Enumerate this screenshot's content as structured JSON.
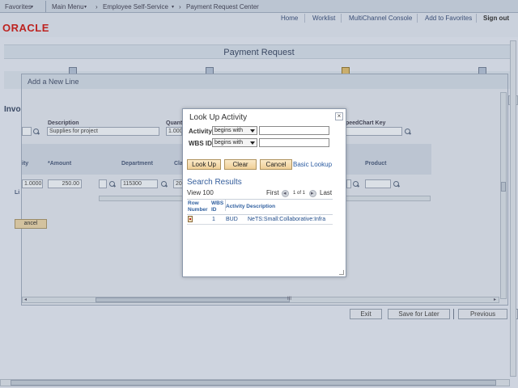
{
  "topbar": {
    "favorites": "Favorites",
    "main_menu": "Main Menu",
    "crumb1": "Employee Self-Service",
    "crumb2": "Payment Request Center"
  },
  "header": {
    "logo": "ORACLE",
    "links": [
      "Home",
      "Worklist",
      "MultiChannel Console",
      "Add to Favorites"
    ],
    "signout": "Sign out"
  },
  "page": {
    "title": "Payment Request"
  },
  "background_modal": {
    "title": "Add a New Line",
    "invoice_label": "Invo",
    "description_label": "Description",
    "description_value": "Supplies for project",
    "quantity_label": "Quant",
    "quantity_value": "1.000",
    "speedchart_label": "peedChart Key",
    "grid_headers": [
      "ity",
      "*Amount",
      "Department",
      "Cla",
      "Product"
    ],
    "row": {
      "qty": "1.0000",
      "amount": "250.00",
      "department": "115300",
      "class": "20"
    },
    "line_label": "Li",
    "cancel_button": "ancel"
  },
  "footer_buttons": {
    "exit": "Exit",
    "save_for_later": "Save for Later",
    "previous": "Previous"
  },
  "lookup": {
    "title": "Look Up Activity",
    "close": "×",
    "activity_label": "Activity:",
    "activity_operator": "begins with",
    "activity_value": "",
    "wbs_label": "WBS ID:",
    "wbs_operator": "begins with",
    "wbs_value": "",
    "buttons": {
      "lookup": "Look Up",
      "clear": "Clear",
      "cancel": "Cancel"
    },
    "basic_lookup": "Basic Lookup",
    "results_title": "Search Results",
    "view_100": "View 100",
    "first": "First",
    "page_info": "1 of 1",
    "last": "Last",
    "columns": {
      "row_number_1": "Row",
      "row_number_2": "Number",
      "wbs_1": "WBS",
      "wbs_2": "ID",
      "activity_description": "Activity Description"
    },
    "rows": [
      {
        "wbs_id": "1",
        "activity": "BUD",
        "description": "NeTS:Small:Collaborative:Infra"
      }
    ]
  },
  "scroll": {
    "thumb_symbol": "III"
  },
  "icons": {
    "lookup": "magnifier-icon",
    "close": "close-icon",
    "row": "row-select-icon"
  }
}
